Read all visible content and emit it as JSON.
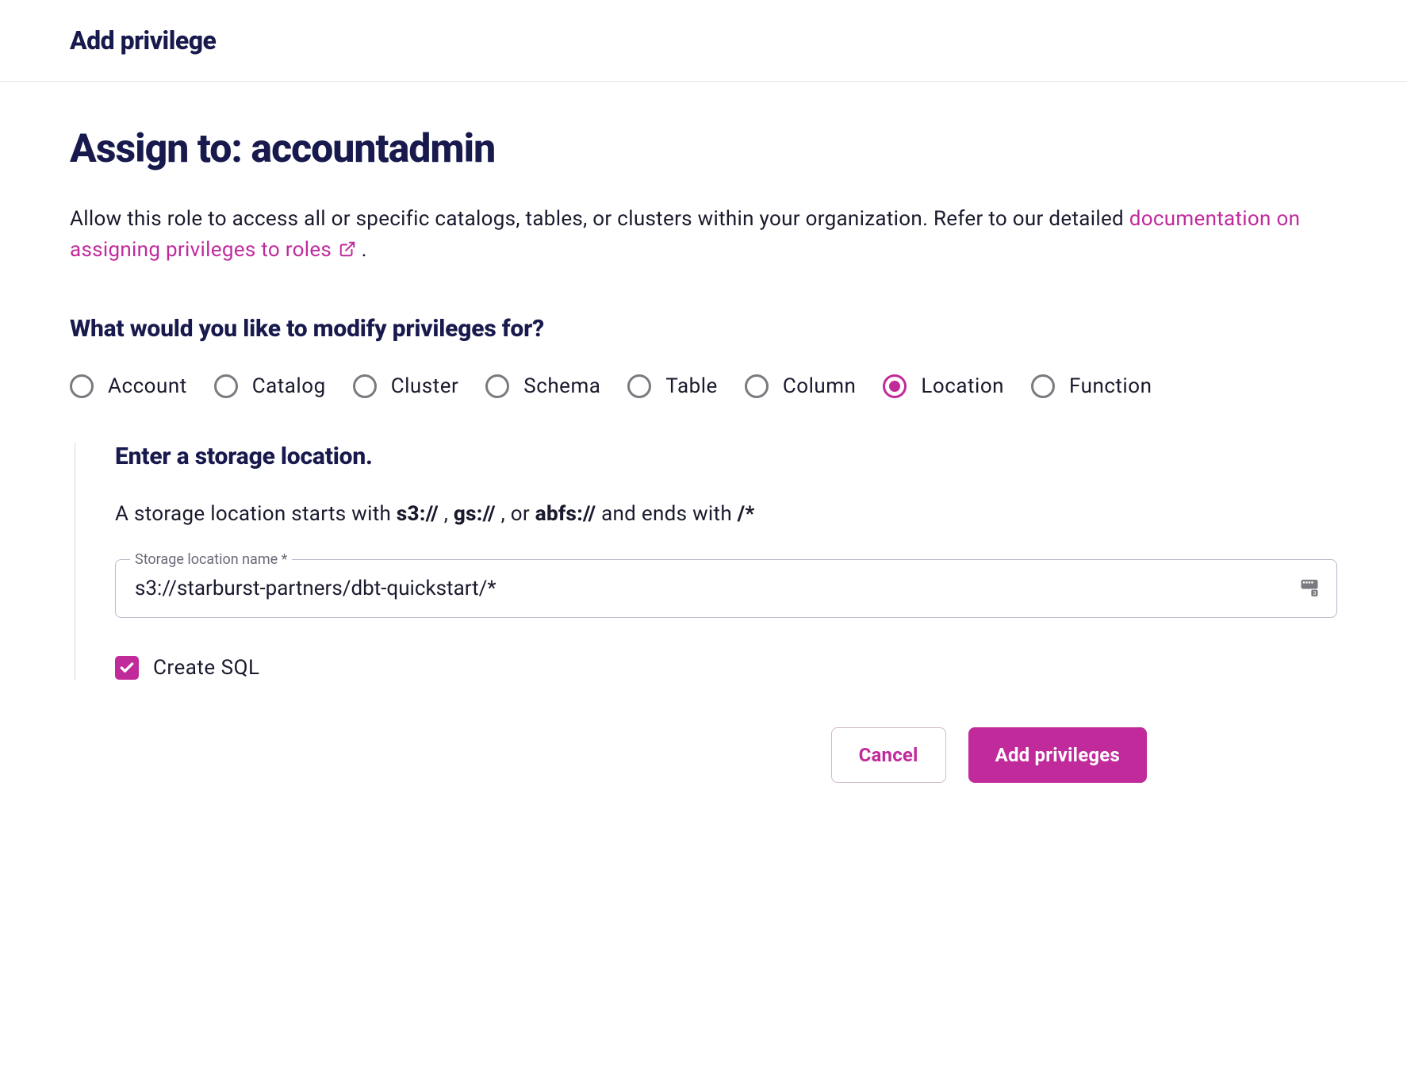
{
  "header": {
    "title": "Add privilege"
  },
  "main": {
    "assign_title": "Assign to: accountadmin",
    "description_prefix": "Allow this role to access all or specific catalogs, tables, or clusters within your organization. Refer to our detailed ",
    "doc_link_text": "documentation on assigning privileges to roles",
    "description_suffix": " .",
    "question": "What would you like to modify privileges for?",
    "radio_options": [
      {
        "key": "account",
        "label": "Account",
        "selected": false
      },
      {
        "key": "catalog",
        "label": "Catalog",
        "selected": false
      },
      {
        "key": "cluster",
        "label": "Cluster",
        "selected": false
      },
      {
        "key": "schema",
        "label": "Schema",
        "selected": false
      },
      {
        "key": "table",
        "label": "Table",
        "selected": false
      },
      {
        "key": "column",
        "label": "Column",
        "selected": false
      },
      {
        "key": "location",
        "label": "Location",
        "selected": true
      },
      {
        "key": "function",
        "label": "Function",
        "selected": false
      }
    ],
    "storage_section": {
      "title": "Enter a storage location.",
      "desc_prefix": "A storage location starts with ",
      "proto1": "s3://",
      "sep1": ", ",
      "proto2": "gs://",
      "sep2": ", or ",
      "proto3": "abfs://",
      "desc_mid": " and ends with ",
      "suffix_pattern": "/*",
      "input_legend": "Storage location name *",
      "input_value": "s3://starburst-partners/dbt-quickstart/*"
    },
    "checkbox": {
      "label": "Create SQL",
      "checked": true
    }
  },
  "footer": {
    "cancel_label": "Cancel",
    "submit_label": "Add privileges"
  }
}
